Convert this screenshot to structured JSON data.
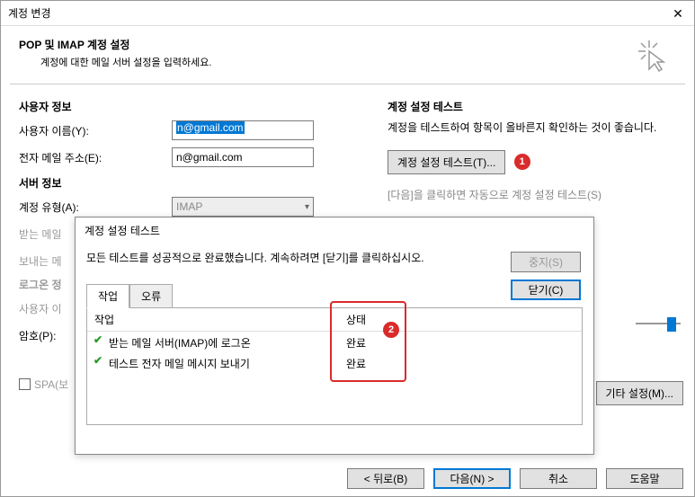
{
  "window": {
    "title": "계정 변경",
    "close": "✕"
  },
  "header": {
    "title": "POP 및 IMAP 계정 설정",
    "subtitle": "계정에 대한 메일 서버 설정을 입력하세요."
  },
  "left": {
    "userinfo_heading": "사용자 정보",
    "username_label": "사용자 이름(Y):",
    "username_value": "n@gmail.com",
    "email_label": "전자 메일 주소(E):",
    "email_value": "n@gmail.com",
    "serverinfo_heading": "서버 정보",
    "accounttype_label": "계정 유형(A):",
    "accounttype_value": "IMAP",
    "incoming_label_partial": "받는 메일",
    "outgoing_label_partial": "보내는 메",
    "login_heading_partial": "로그온 정",
    "uid_label_partial": "사용자 이",
    "password_label": "암호(P):",
    "spa_label_partial": "SPA(보"
  },
  "right": {
    "test_heading": "계정 설정 테스트",
    "test_desc": "계정을 테스트하여 항목이 올바른지 확인하는 것이 좋습니다.",
    "test_button": "계정 설정 테스트(T)...",
    "auto_test_partial": "[다음]을 클릭하면 자동으로 계정 설정 테스트(S)",
    "other_button": "기타 설정(M)..."
  },
  "badges": {
    "b1": "1",
    "b2": "2"
  },
  "inner": {
    "title": "계정 설정 테스트",
    "message": "모든 테스트를 성공적으로 완료했습니다. 계속하려면 [닫기]를 클릭하십시오.",
    "stop_button": "중지(S)",
    "close_button": "닫기(C)",
    "tab_tasks": "작업",
    "tab_errors": "오류",
    "col_task": "작업",
    "col_status": "상태",
    "rows": [
      {
        "text": "받는 메일 서버(IMAP)에 로그온",
        "status": "완료"
      },
      {
        "text": "테스트 전자 메일 메시지 보내기",
        "status": "완료"
      }
    ]
  },
  "bottom": {
    "back": "< 뒤로(B)",
    "next": "다음(N) >",
    "cancel": "취소",
    "help": "도움말"
  }
}
